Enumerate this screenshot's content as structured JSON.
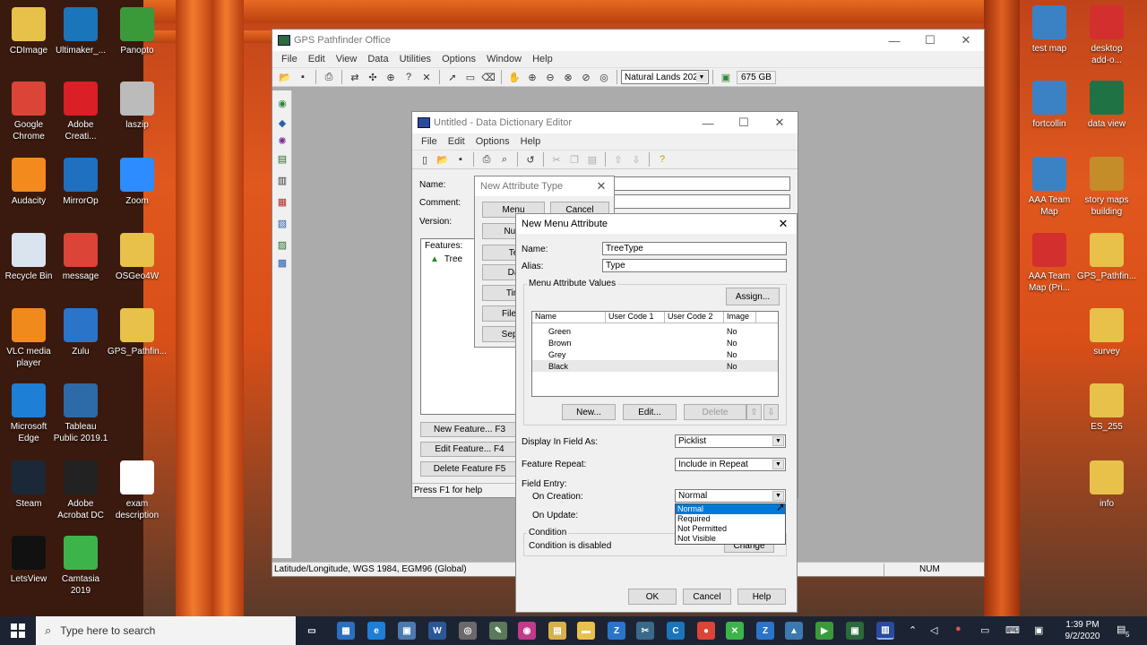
{
  "desktop": {
    "left_icons": [
      {
        "label": "CDImage",
        "icon": "folder-icon",
        "color": "#e8c14a"
      },
      {
        "label": "Ultimaker_...",
        "icon": "cura-icon",
        "color": "#1b75bb"
      },
      {
        "label": "Panopto",
        "icon": "panopto-icon",
        "color": "#3a9a3a"
      },
      {
        "label": "Google\nChrome",
        "icon": "chrome-icon",
        "color": "#db4437"
      },
      {
        "label": "Adobe\nCreati...",
        "icon": "creative-cloud-icon",
        "color": "#da1f26"
      },
      {
        "label": "laszip",
        "icon": "laszip-icon",
        "color": "#bbbbbb"
      },
      {
        "label": "Audacity",
        "icon": "audacity-icon",
        "color": "#f28a1e"
      },
      {
        "label": "MirrorOp",
        "icon": "mirrorop-icon",
        "color": "#1f70c1"
      },
      {
        "label": "Zoom",
        "icon": "zoom-icon",
        "color": "#2d8cff"
      },
      {
        "label": "Recycle Bin",
        "icon": "recycle-bin-icon",
        "color": "#d9e4ef"
      },
      {
        "label": "message",
        "icon": "chrome-icon",
        "color": "#db4437"
      },
      {
        "label": "OSGeo4W",
        "icon": "folder-icon",
        "color": "#e8c14a"
      },
      {
        "label": "VLC media\nplayer",
        "icon": "vlc-icon",
        "color": "#f18a1c"
      },
      {
        "label": "Zulu",
        "icon": "zulu-icon",
        "color": "#2a75c9"
      },
      {
        "label": "GPS_Pathfin...",
        "icon": "folder-icon",
        "color": "#e8c14a"
      },
      {
        "label": "Microsoft\nEdge",
        "icon": "edge-icon",
        "color": "#1e7fd6"
      },
      {
        "label": "Tableau\nPublic 2019.1",
        "icon": "tableau-icon",
        "color": "#2d6aa8"
      },
      {
        "label": "Steam",
        "icon": "steam-icon",
        "color": "#1b2838"
      },
      {
        "label": "Adobe\nAcrobat DC",
        "icon": "acrobat-icon",
        "color": "#222222"
      },
      {
        "label": "exam\ndescription",
        "icon": "video-file-icon",
        "color": "#ffffff"
      },
      {
        "label": "LetsView",
        "icon": "letsview-icon",
        "color": "#111111"
      },
      {
        "label": "Camtasia\n2019",
        "icon": "camtasia-icon",
        "color": "#3cb44a"
      }
    ],
    "right_icons": [
      {
        "label": "test map",
        "icon": "arcgis-icon",
        "color": "#3b82c4"
      },
      {
        "label": "desktop\nadd-o...",
        "icon": "pdf-icon",
        "color": "#d32f2f"
      },
      {
        "label": "fortcollin",
        "icon": "arcgis-icon",
        "color": "#3b82c4"
      },
      {
        "label": "data view",
        "icon": "excel-icon",
        "color": "#1f7244"
      },
      {
        "label": "AAA Team\nMap",
        "icon": "arcgis-icon",
        "color": "#3b82c4"
      },
      {
        "label": "story maps\nbuilding",
        "icon": "folder-icon",
        "color": "#c58c2a"
      },
      {
        "label": "AAA Team\nMap (Pri...",
        "icon": "pdf-icon",
        "color": "#d32f2f"
      },
      {
        "label": "GPS_Pathfin...",
        "icon": "folder-icon",
        "color": "#e8c14a"
      },
      {
        "label": "survey",
        "icon": "folder-icon",
        "color": "#e8c14a"
      },
      {
        "label": "ES_255",
        "icon": "folder-icon",
        "color": "#e8c14a"
      },
      {
        "label": "info",
        "icon": "folder-icon",
        "color": "#e8c14a"
      }
    ]
  },
  "gps_window": {
    "title": "GPS Pathfinder Office",
    "menu": [
      "File",
      "Edit",
      "View",
      "Data",
      "Utilities",
      "Options",
      "Window",
      "Help"
    ],
    "background_file": "Natural Lands 2020",
    "disk_space": "675 GB",
    "status_left": "Latitude/Longitude, WGS 1984, EGM96 (Global)",
    "status_num": "NUM"
  },
  "dde_window": {
    "title": "Untitled - Data Dictionary Editor",
    "menu": [
      "File",
      "Edit",
      "Options",
      "Help"
    ],
    "name_label": "Name:",
    "comment_label": "Comment:",
    "version_label": "Version:",
    "features_label": "Features:",
    "feature_item": "Tree",
    "new_feature": "New Feature... F3",
    "edit_feature": "Edit Feature... F4",
    "delete_feature": "Delete Feature F5",
    "status": "Press F1 for help"
  },
  "nat_dialog": {
    "title": "New Attribute Type",
    "buttons": [
      "Menu",
      "Cancel",
      "Num",
      "Te",
      "Da",
      "Tim",
      "File N",
      "Separ"
    ]
  },
  "nma_dialog": {
    "title": "New Menu Attribute",
    "name_label": "Name:",
    "name_value": "TreeType",
    "alias_label": "Alias:",
    "alias_value": "Type",
    "values_group": "Menu Attribute Values",
    "assign": "Assign...",
    "columns": [
      "Name",
      "User Code 1",
      "User Code 2",
      "Image"
    ],
    "rows": [
      {
        "name": "Green",
        "uc1": "",
        "uc2": "",
        "image": "No"
      },
      {
        "name": "Brown",
        "uc1": "",
        "uc2": "",
        "image": "No"
      },
      {
        "name": "Grey",
        "uc1": "",
        "uc2": "",
        "image": "No"
      },
      {
        "name": "Black",
        "uc1": "",
        "uc2": "",
        "image": "No"
      }
    ],
    "new_btn": "New...",
    "edit_btn": "Edit...",
    "delete_btn": "Delete",
    "display_label": "Display In Field As:",
    "display_value": "Picklist",
    "repeat_label": "Feature Repeat:",
    "repeat_value": "Include in Repeat",
    "field_entry_label": "Field Entry:",
    "on_creation_label": "On Creation:",
    "on_creation_value": "Normal",
    "on_update_label": "On Update:",
    "dropdown_options": [
      "Normal",
      "Required",
      "Not Permitted",
      "Not Visible"
    ],
    "condition_group": "Condition",
    "condition_text": "Condition is disabled",
    "change_btn": "Change",
    "ok": "OK",
    "cancel": "Cancel",
    "help": "Help"
  },
  "taskbar": {
    "search_placeholder": "Type here to search",
    "time": "1:39 PM",
    "date": "9/2/2020",
    "notification_count": "5"
  }
}
